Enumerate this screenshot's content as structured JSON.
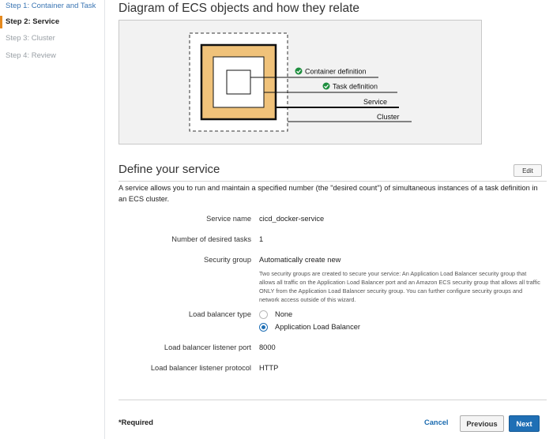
{
  "sidebar": {
    "steps": [
      {
        "label": "Step 1: Container and Task",
        "state": "completed"
      },
      {
        "label": "Step 2: Service",
        "state": "active"
      },
      {
        "label": "Step 3: Cluster",
        "state": "upcoming"
      },
      {
        "label": "Step 4: Review",
        "state": "upcoming"
      }
    ]
  },
  "diagram": {
    "title": "Diagram of ECS objects and how they relate",
    "labels": {
      "container_definition": "Container definition",
      "task_definition": "Task definition",
      "service": "Service",
      "cluster": "Cluster"
    },
    "colors": {
      "service_fill": "#f0c27a",
      "check": "#1e8e3e"
    }
  },
  "service": {
    "title": "Define your service",
    "edit_label": "Edit",
    "description": "A service allows you to run and maintain a specified number (the \"desired count\") of simultaneous instances of a task definition in an ECS cluster.",
    "fields": {
      "service_name_label": "Service name",
      "service_name_value": "cicd_docker-service",
      "desired_tasks_label": "Number of desired tasks",
      "desired_tasks_value": "1",
      "security_group_label": "Security group",
      "security_group_value": "Automatically create new",
      "security_group_help": "Two security groups are created to secure your service: An Application Load Balancer security group that allows all traffic on the Application Load Balancer port and an Amazon ECS security group that allows all traffic ONLY from the Application Load Balancer security group. You can further configure security groups and network access outside of this wizard.",
      "lb_type_label": "Load balancer type",
      "lb_type_options": [
        {
          "label": "None",
          "selected": false
        },
        {
          "label": "Application Load Balancer",
          "selected": true
        }
      ],
      "listener_port_label": "Load balancer listener port",
      "listener_port_value": "8000",
      "listener_protocol_label": "Load balancer listener protocol",
      "listener_protocol_value": "HTTP"
    }
  },
  "footer": {
    "required_label": "*Required",
    "cancel_label": "Cancel",
    "previous_label": "Previous",
    "next_label": "Next"
  },
  "colors": {
    "accent": "#1f6fb5",
    "step_indicator": "#e58a1f",
    "link": "#1a6bb0"
  }
}
